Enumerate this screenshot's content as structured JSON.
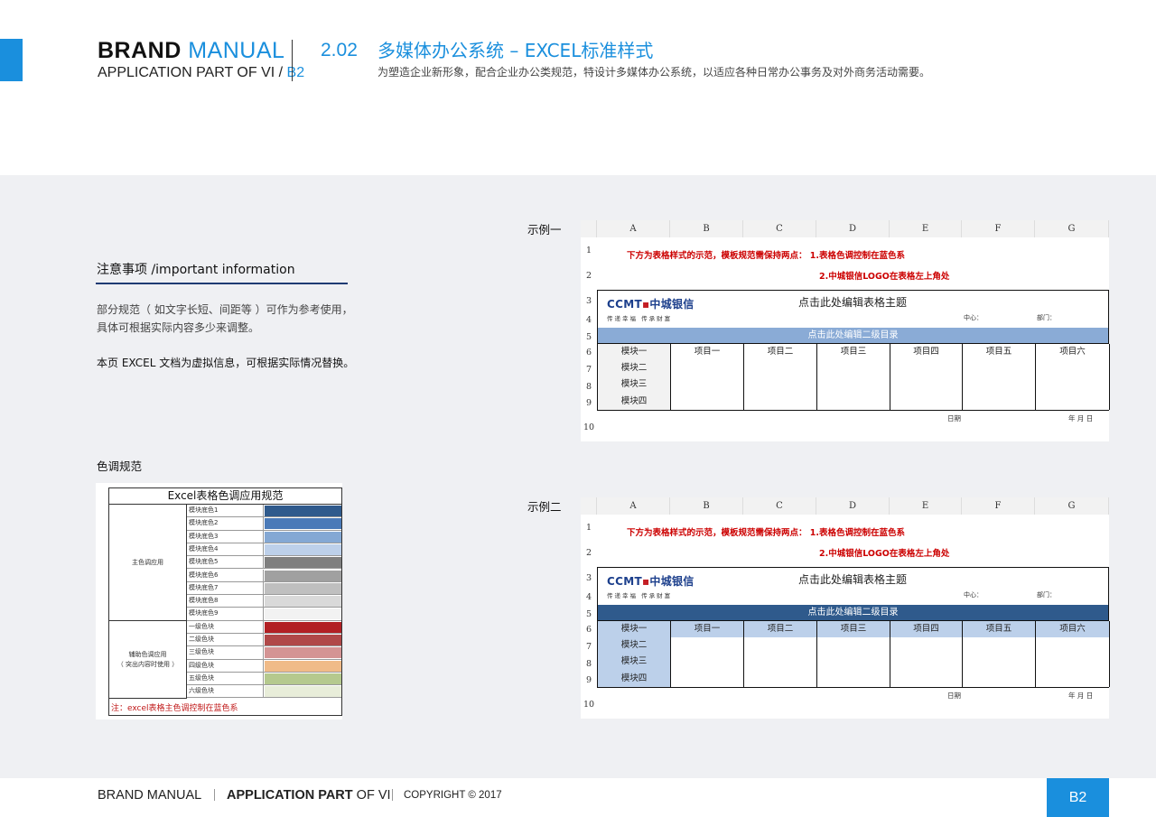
{
  "header": {
    "brand_bold": "BRAND",
    "brand_light": "MANUAL",
    "app_part": "APPLICATION PART OF VI /",
    "app_code": "B2",
    "section_number": "2.02",
    "section_title": "多媒体办公系统 – EXCEL标准样式",
    "section_desc": "为塑造企业新形象，配合企业办公类规范，特设计多媒体办公系统，以适应各种日常办公事务及对外商务活动需要。"
  },
  "notes": {
    "title": "注意事项 /important information",
    "line1": "部分规范（ 如文字长短、间距等 ）可作为参考使用，",
    "line2": "具体可根据实际内容多少来调整。",
    "line3": "本页 EXCEL 文档为虚拟信息，可根据实际情况替换。"
  },
  "tone": {
    "title": "色调规范",
    "table_title": "Excel表格色调应用规范",
    "group1_label": "主色调应用",
    "group2_label_1": "辅助色调应用",
    "group2_label_2": "（ 突出内容时使用 ）",
    "note": "注：excel表格主色调控制在蓝色系",
    "rows": [
      {
        "label": "模块底色1",
        "color": "#2f5a8c"
      },
      {
        "label": "模块底色2",
        "color": "#4a7ab8"
      },
      {
        "label": "模块底色3",
        "color": "#84a8d4"
      },
      {
        "label": "模块底色4",
        "color": "#bdd0ea"
      },
      {
        "label": "模块底色5",
        "color": "#7f7f7f"
      },
      {
        "label": "模块底色6",
        "color": "#a0a0a0"
      },
      {
        "label": "模块底色7",
        "color": "#bfbfbf"
      },
      {
        "label": "模块底色8",
        "color": "#d9d9d9"
      },
      {
        "label": "模块底色9",
        "color": "#f2f2f2"
      },
      {
        "label": "一级色块",
        "color": "#b22024"
      },
      {
        "label": "二级色块",
        "color": "#b04848"
      },
      {
        "label": "三级色块",
        "color": "#d49494"
      },
      {
        "label": "四级色块",
        "color": "#f0bb88"
      },
      {
        "label": "五级色块",
        "color": "#b5c98e"
      },
      {
        "label": "六级色块",
        "color": "#e8edd9"
      }
    ]
  },
  "samples": [
    {
      "label": "示例一",
      "subhead_bg": "#8aabd6",
      "rowlabel_bg": "#f2f2f2",
      "header_bg": "#ffffff"
    },
    {
      "label": "示例二",
      "subhead_bg": "#2f5a8c",
      "rowlabel_bg": "#bcd0ea",
      "header_bg": "#bcd0ea"
    }
  ],
  "sheet": {
    "columns": [
      "A",
      "B",
      "C",
      "D",
      "E",
      "F",
      "G"
    ],
    "rows": [
      "1",
      "2",
      "3",
      "4",
      "5",
      "6",
      "7",
      "8",
      "9",
      "10"
    ],
    "red_line1": "下方为表格样式的示范，模板规范需保持两点：  1.表格色调控制在蓝色系",
    "red_line2": "2.中城银信LOGO在表格左上角处",
    "logo_main": "CCMT",
    "logo_cn": "中城银信",
    "logo_sub": "传递幸福  传承财富",
    "title": "点击此处编辑表格主题",
    "center_label": "中心：",
    "dept_label": "部门：",
    "subhead": "点击此处编辑二级目录",
    "header_row": [
      "模块一",
      "项目一",
      "项目二",
      "项目三",
      "项目四",
      "项目五",
      "项目六"
    ],
    "row_labels": [
      "模块二",
      "模块三",
      "模块四"
    ],
    "date_label": "日期",
    "ymd": "年   月   日"
  },
  "footer": {
    "brand": "BRAND MANUAL",
    "app_bold": "APPLICATION PART",
    "app_rest": "OF VI",
    "copyright": "COPYRIGHT © 2017",
    "page": "B2"
  }
}
